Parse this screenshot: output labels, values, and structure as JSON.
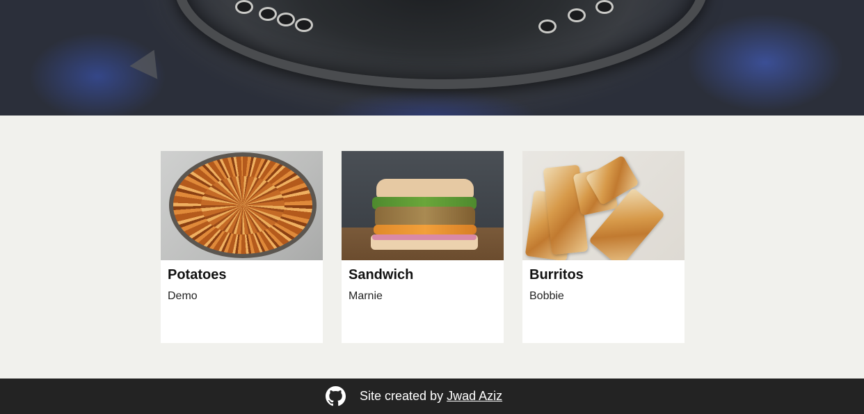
{
  "hero": {
    "image": "gas-burner-photo"
  },
  "recipes": [
    {
      "title": "Potatoes",
      "author": "Demo",
      "image": "potato-gratin-photo"
    },
    {
      "title": "Sandwich",
      "author": "Marnie",
      "image": "sandwich-photo"
    },
    {
      "title": "Burritos",
      "author": "Bobbie",
      "image": "burritos-photo"
    }
  ],
  "footer": {
    "icon": "github-icon",
    "text": "Site created by",
    "link_text": "Jwad Aziz"
  },
  "colors": {
    "page_background": "#f1f1ed",
    "card_background": "#ffffff",
    "footer_background": "#232323",
    "footer_text": "#ffffff"
  }
}
